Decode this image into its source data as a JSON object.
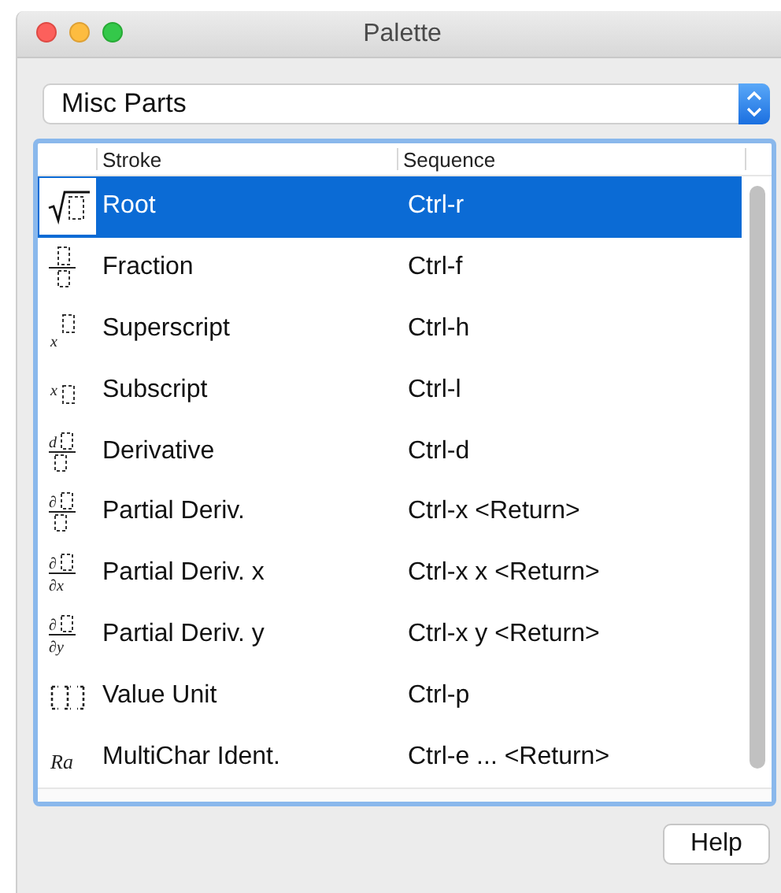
{
  "window": {
    "title": "Palette"
  },
  "category_select": {
    "value": "Misc Parts"
  },
  "table": {
    "columns": [
      "Stroke",
      "Sequence"
    ],
    "rows": [
      {
        "icon": {
          "kind": "root"
        },
        "stroke": "Root",
        "sequence": "Ctrl-r",
        "selected": true
      },
      {
        "icon": {
          "kind": "fraction"
        },
        "stroke": "Fraction",
        "sequence": "Ctrl-f",
        "selected": false
      },
      {
        "icon": {
          "kind": "superscript",
          "base": "x"
        },
        "stroke": "Superscript",
        "sequence": "Ctrl-h",
        "selected": false
      },
      {
        "icon": {
          "kind": "subscript",
          "base": "x"
        },
        "stroke": "Subscript",
        "sequence": "Ctrl-l",
        "selected": false
      },
      {
        "icon": {
          "kind": "fraction",
          "top": "d"
        },
        "stroke": "Derivative",
        "sequence": "Ctrl-d",
        "selected": false
      },
      {
        "icon": {
          "kind": "fraction",
          "top": "∂"
        },
        "stroke": "Partial Deriv.",
        "sequence": "Ctrl-x <Return>",
        "selected": false
      },
      {
        "icon": {
          "kind": "fraction",
          "top": "∂",
          "bottom": "∂x"
        },
        "stroke": "Partial Deriv. x",
        "sequence": "Ctrl-x x <Return>",
        "selected": false
      },
      {
        "icon": {
          "kind": "fraction",
          "top": "∂",
          "bottom": "∂y"
        },
        "stroke": "Partial Deriv. y",
        "sequence": "Ctrl-x y <Return>",
        "selected": false
      },
      {
        "icon": {
          "kind": "unit"
        },
        "stroke": "Value Unit",
        "sequence": "Ctrl-p",
        "selected": false
      },
      {
        "icon": {
          "kind": "text",
          "text": "Ra"
        },
        "stroke": "MultiChar Ident.",
        "sequence": "Ctrl-e ... <Return>",
        "selected": false
      }
    ]
  },
  "buttons": [
    "Help"
  ]
}
